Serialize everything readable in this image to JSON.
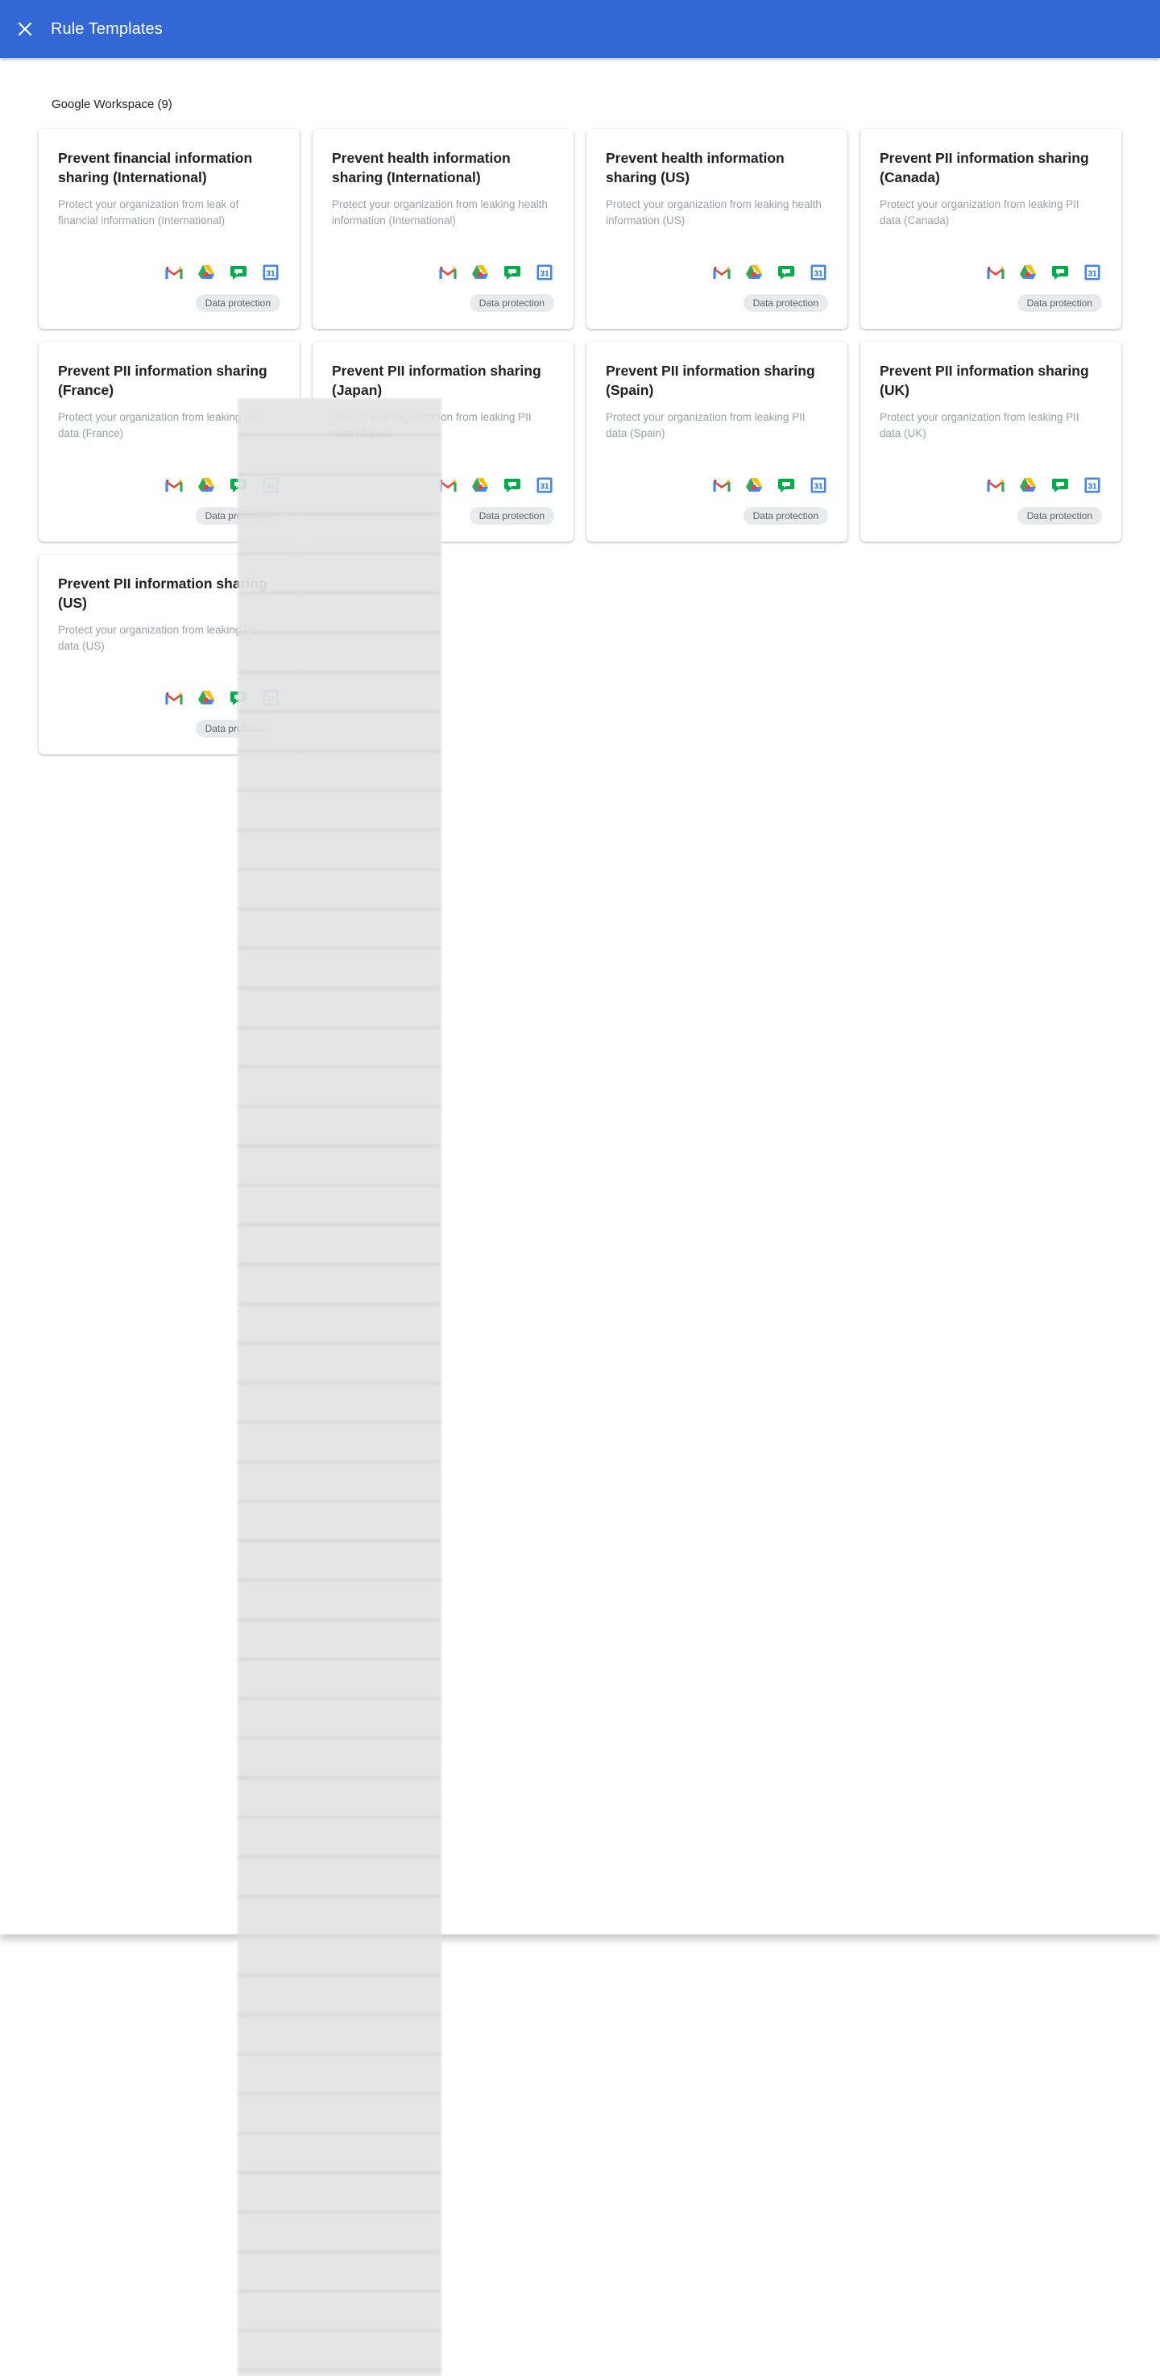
{
  "app": {
    "title": "Rule Templates"
  },
  "section": {
    "heading": "Google Workspace (9)"
  },
  "colors": {
    "header": "#3367d6",
    "badge_bg": "#e8eaed"
  },
  "card_icons": [
    "gmail-icon",
    "drive-icon",
    "chat-icon",
    "calendar-icon"
  ],
  "calendar_icon_text": "31",
  "cards": [
    {
      "title": "Prevent financial information sharing (International)",
      "description": "Protect your organization from leak of financial information (International)",
      "badge": "Data protection"
    },
    {
      "title": "Prevent health information sharing (International)",
      "description": "Protect your organization from leaking health information (International)",
      "badge": "Data protection"
    },
    {
      "title": "Prevent health information sharing (US)",
      "description": "Protect your organization from leaking health information (US)",
      "badge": "Data protection"
    },
    {
      "title": "Prevent PII information sharing (Canada)",
      "description": "Protect your organization from leaking PII data (Canada)",
      "badge": "Data protection"
    },
    {
      "title": "Prevent PII information sharing (France)",
      "description": "Protect your organization from leaking PII data (France)",
      "badge": "Data protection"
    },
    {
      "title": "Prevent PII information sharing (Japan)",
      "description": "Protect your organization from leaking PII data (Japan)",
      "badge": "Data protection"
    },
    {
      "title": "Prevent PII information sharing (Spain)",
      "description": "Protect your organization from leaking PII data (Spain)",
      "badge": "Data protection"
    },
    {
      "title": "Prevent PII information sharing (UK)",
      "description": "Protect your organization from leaking PII data (UK)",
      "badge": "Data protection"
    },
    {
      "title": "Prevent PII information sharing (US)",
      "description": "Protect your organization from leaking PII data (US)",
      "badge": "Data protection"
    }
  ]
}
